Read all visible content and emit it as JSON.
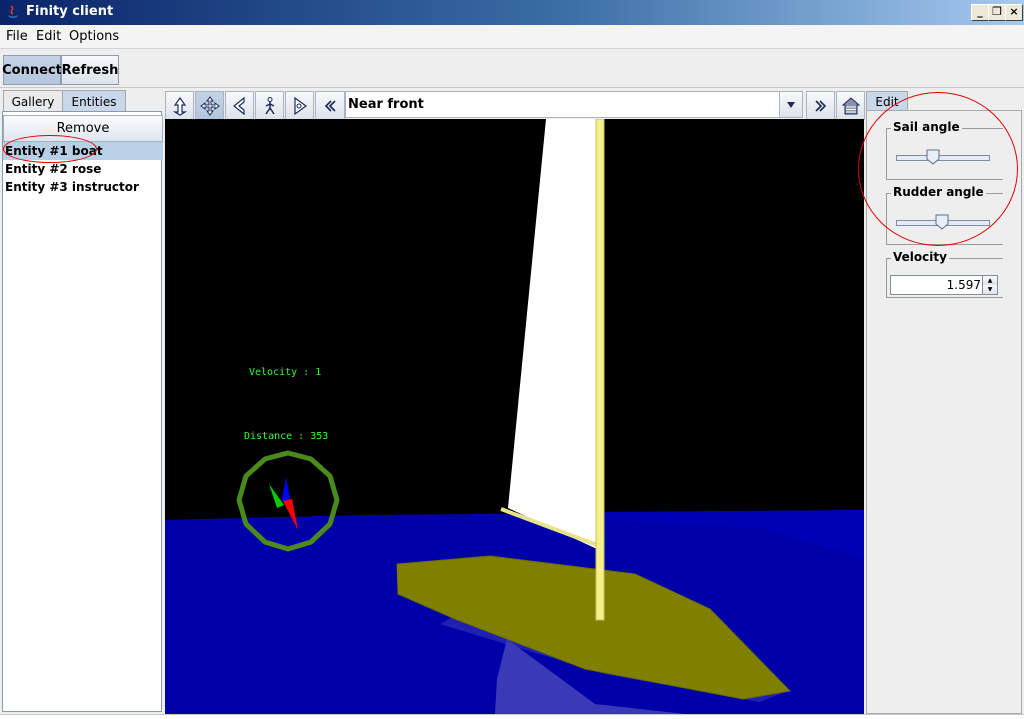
{
  "window": {
    "title": "Finity client"
  },
  "menu": [
    "File",
    "Edit",
    "Options"
  ],
  "toolbar": {
    "connect_label": "Connect",
    "refresh_label": "Refresh"
  },
  "left": {
    "tabs": [
      "Gallery",
      "Entities"
    ],
    "remove_label": "Remove",
    "entities": [
      "Entity #1 boat",
      "Entity #2 rose",
      "Entity #3 instructor"
    ]
  },
  "viewer": {
    "icons": [
      "rotate-view-icon",
      "pan-view-icon",
      "fly-view-icon",
      "walk-view-icon",
      "examine-view-icon",
      "previous-viewpoint-icon",
      "next-viewpoint-icon",
      "home-viewpoint-icon"
    ],
    "viewpoint": "Near front",
    "hud": {
      "velocity": "Velocity : 1",
      "distance": "Distance : 353"
    }
  },
  "right": {
    "tab": "Edit",
    "sail_label": "Sail angle",
    "sail_value": 0.4,
    "rudder_label": "Rudder angle",
    "rudder_value": 0.5,
    "velocity_label": "Velocity",
    "velocity_value": "1.597"
  },
  "colors": {
    "sky": "#000000",
    "sea": "#0000a8",
    "hull": "#808000",
    "sail": "#ffffff",
    "mast": "#f5f080",
    "hud_text": "#33ff33",
    "compass": "#4a8a1a",
    "annotation": "#e00000"
  }
}
